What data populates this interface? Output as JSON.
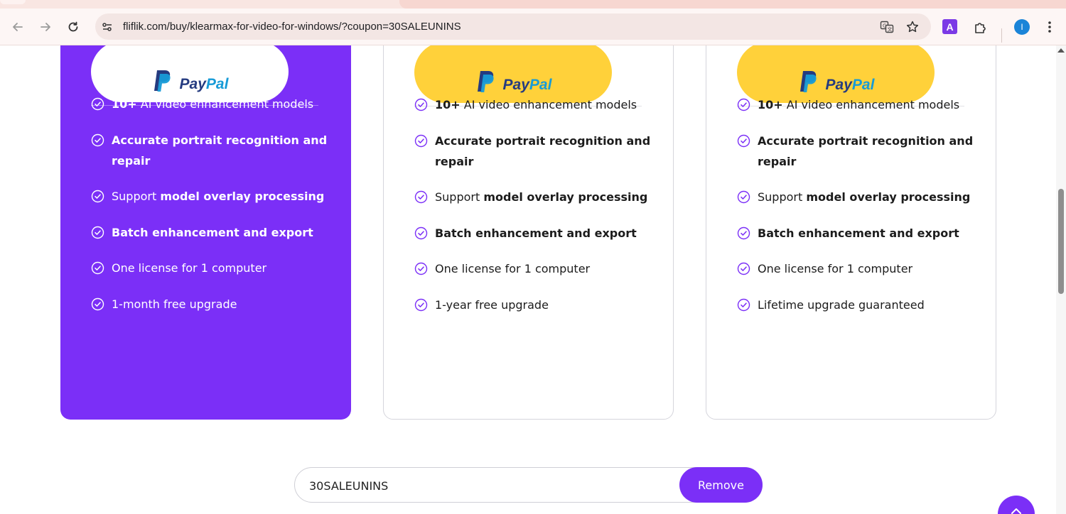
{
  "browser": {
    "url": "fliflik.com/buy/klearmax-for-video-for-windows/?coupon=30SALEUNINS",
    "extension_label": "A",
    "avatar_letter": "I"
  },
  "paypal": {
    "word_a": "Pay",
    "word_b": "Pal"
  },
  "plans": [
    {
      "style": "featured",
      "features": [
        {
          "bold": "10+",
          "text": " AI video enhancement models"
        },
        {
          "bold": "Accurate portrait recognition and",
          "text": ""
        },
        {
          "bold": "repair",
          "text": ""
        },
        {
          "pre": "Support ",
          "bold": "model overlay processing",
          "text": ""
        },
        {
          "bold": "Batch enhancement and export",
          "text": ""
        },
        {
          "text": "One license for 1 computer"
        },
        {
          "text": "1-month free upgrade"
        }
      ]
    },
    {
      "style": "plain",
      "features": [
        {
          "bold": "10+",
          "text": " AI video enhancement models"
        },
        {
          "bold": "Accurate portrait recognition and",
          "text": ""
        },
        {
          "bold": "repair",
          "text": ""
        },
        {
          "pre": "Support ",
          "bold": "model overlay processing",
          "text": ""
        },
        {
          "bold": "Batch enhancement and export",
          "text": ""
        },
        {
          "text": "One license for 1 computer"
        },
        {
          "text": "1-year free upgrade"
        }
      ]
    },
    {
      "style": "plain",
      "features": [
        {
          "bold": "10+",
          "text": " AI video enhancement models"
        },
        {
          "bold": "Accurate portrait recognition and",
          "text": ""
        },
        {
          "bold": "repair",
          "text": ""
        },
        {
          "pre": "Support ",
          "bold": "model overlay processing",
          "text": ""
        },
        {
          "bold": "Batch enhancement and export",
          "text": ""
        },
        {
          "text": "One license for 1 computer"
        },
        {
          "text": "Lifetime upgrade guaranteed"
        }
      ]
    }
  ],
  "coupon": {
    "value": "30SALEUNINS",
    "button_label": "Remove"
  },
  "colors": {
    "accent": "#7b2ff7",
    "paypal_yellow": "#ffd13a",
    "paypal_dark": "#253b80",
    "paypal_light": "#179bd7"
  },
  "icons": [
    "back-arrow-icon",
    "forward-arrow-icon",
    "reload-icon",
    "site-settings-icon",
    "translate-icon",
    "bookmark-star-icon",
    "extension-puzzle-icon",
    "more-menu-icon",
    "check-circle-icon",
    "chevron-up-icon"
  ]
}
